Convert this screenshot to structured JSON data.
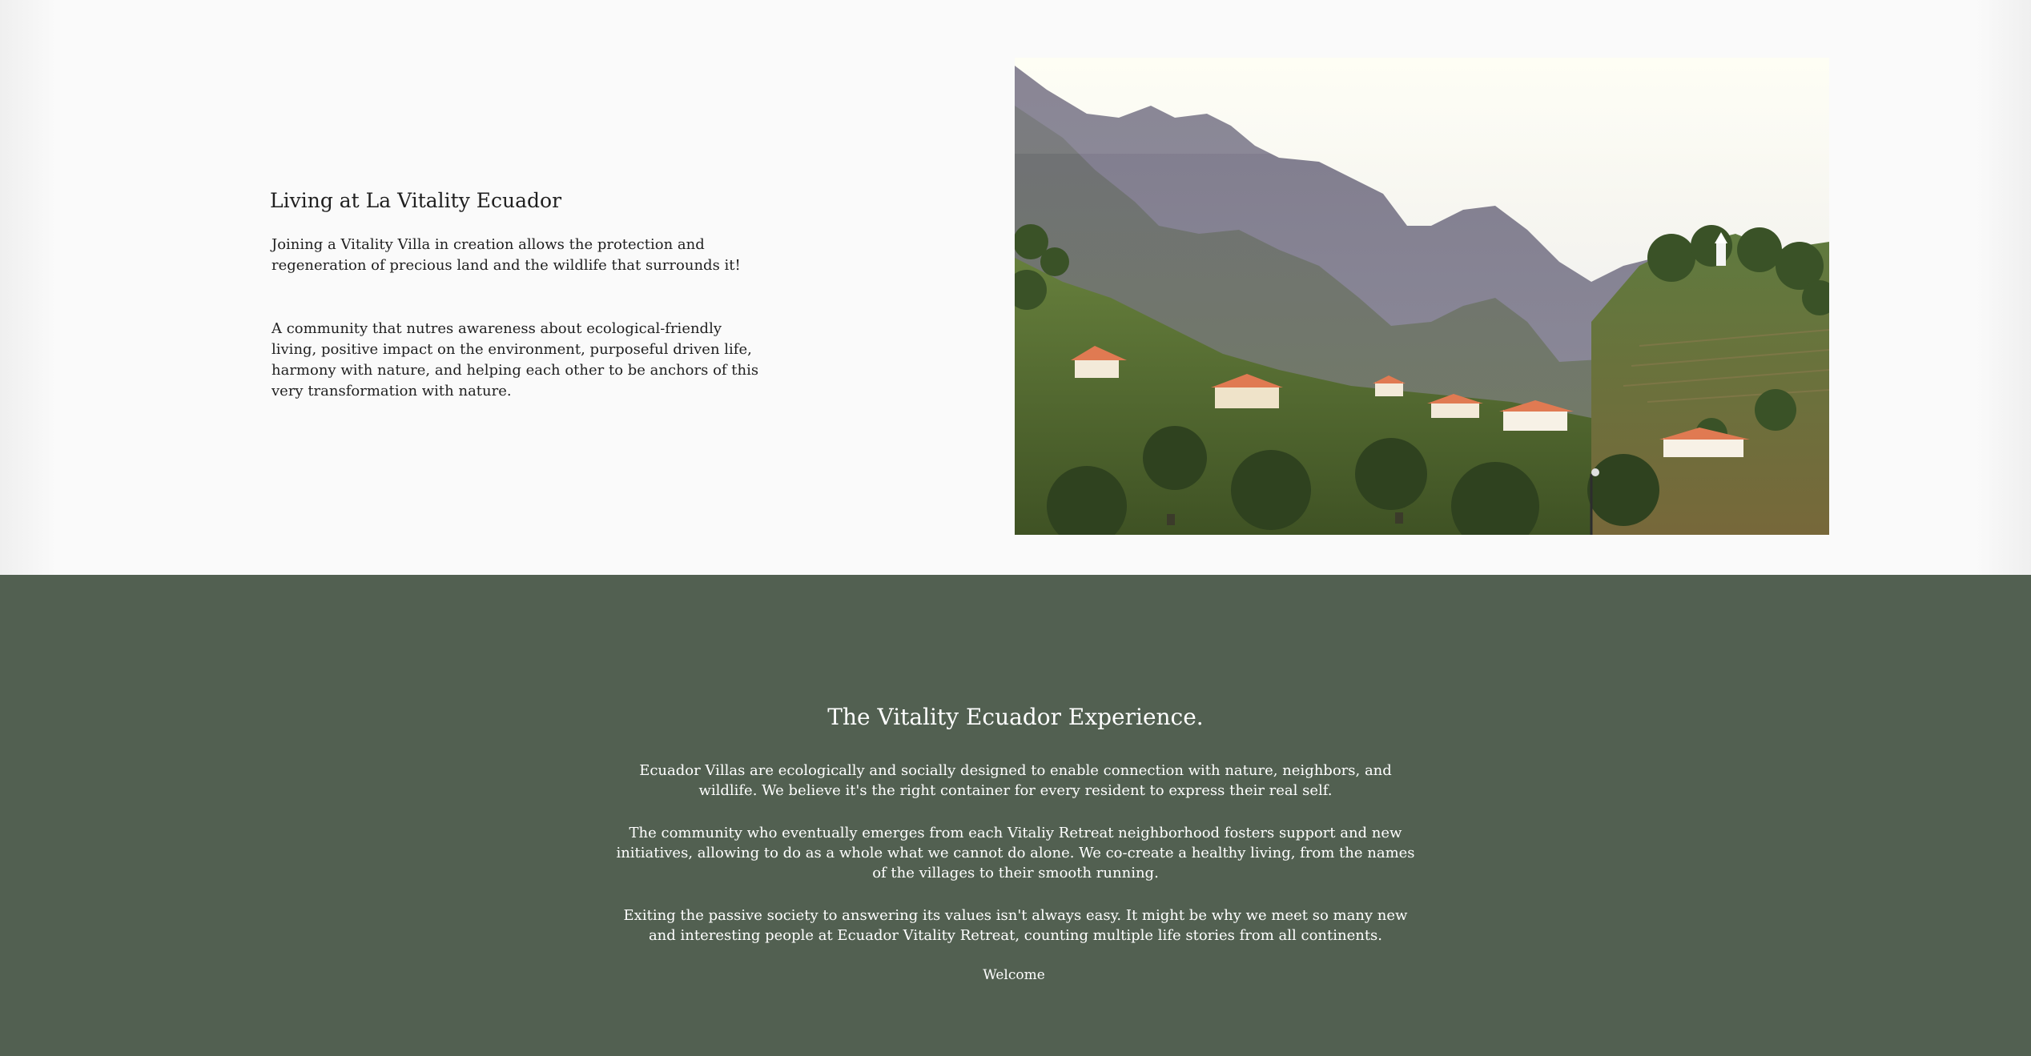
{
  "intro": {
    "title": "Living at La Vitality Ecuador",
    "paragraph_1": "Joining a Vitality Villa in creation allows the protection and regeneration of precious land and the wildlife that surrounds it!",
    "paragraph_2": "A community that nutres awareness about ecological-friendly living, positive impact on the environment, purposeful driven life, harmony with nature, and helping each other to be anchors of this very transformation with nature."
  },
  "landscape_image": {
    "icon": "mountain-village-photo",
    "colors": {
      "sky": "#fdfdf0",
      "far_mountain": "#8a8898",
      "near_mountain": "#6f7a6a",
      "vegetation": "#4f6a33",
      "roof": "#e07a52",
      "wall": "#f3ead9"
    }
  },
  "experience": {
    "title": "The Vitality Ecuador Experience.",
    "paragraph_1": "Ecuador Villas are ecologically and socially designed to enable connection with nature, neighbors, and wildlife. We believe it's the right container for every resident to express their real self.",
    "paragraph_2": "The community who eventually emerges from each Vitaliy Retreat neighborhood fosters support and new initiatives, allowing to do as a whole what we cannot do alone. We co-create a healthy living, from the names of the villages to their smooth running.",
    "paragraph_3": "Exiting the passive society to answering its values isn't always easy. It might be why we meet so many new and interesting people at Ecuador Vitality Retreat, counting multiple life stories from all continents.",
    "welcome": "Welcome",
    "background_color": "#526051"
  }
}
